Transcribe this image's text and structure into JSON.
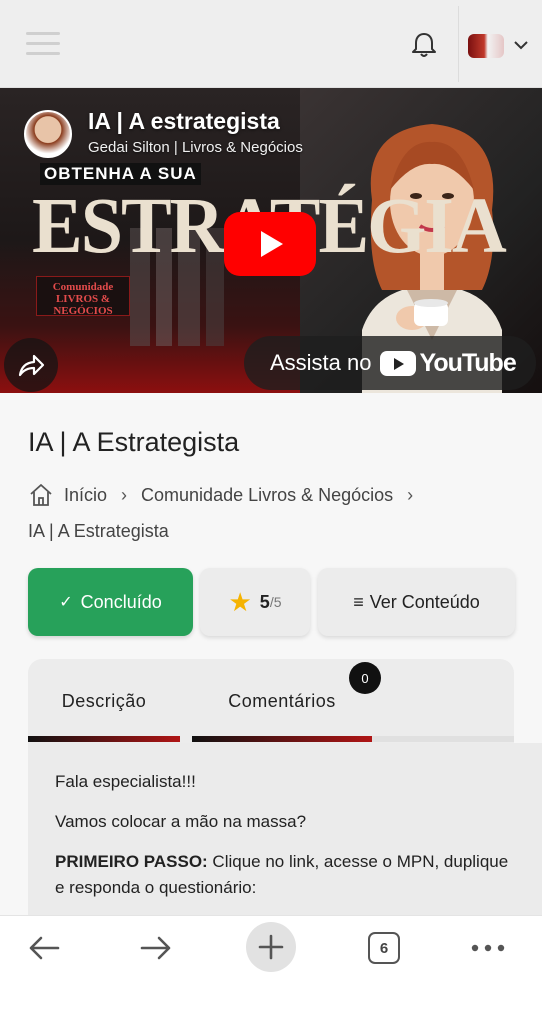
{
  "topbar": {
    "menu_icon": "hamburger-icon",
    "notification_icon": "bell-icon",
    "avatar_icon": "brand-avatar",
    "dropdown_icon": "chevron-down-icon"
  },
  "video": {
    "title": "IA | A estrategista",
    "channel": "Gedai Silton | Livros & Negócios",
    "thumbnail_tagline": "OBTENHA A SUA",
    "thumbnail_headline": "ESTRATÉGIA",
    "thumbnail_brand": "Comunidade LIVROS & NEGÓCIOS",
    "watch_label": "Assista no",
    "youtube_word": "YouTube",
    "play_color": "#ff0000"
  },
  "page": {
    "title": "IA | A Estrategista"
  },
  "breadcrumb": {
    "items": [
      "Início",
      "Comunidade Livros & Negócios",
      "IA | A Estrategista"
    ]
  },
  "actions": {
    "done_label": "Concluído",
    "rating_value": "5",
    "rating_max": "/5",
    "content_label": "Ver Conteúdo",
    "done_color": "#27a15a"
  },
  "tabs": {
    "items": [
      "Descrição",
      "Comentários"
    ],
    "comments_badge": "0"
  },
  "description": {
    "line1": "Fala especialista!!!",
    "line2": "Vamos colocar a mão na massa?",
    "step_label": "PRIMEIRO PASSO:",
    "step_text": " Clique no link, acesse o MPN, duplique  e responda o questionário:"
  },
  "bottom_nav": {
    "tab_count": "6"
  }
}
